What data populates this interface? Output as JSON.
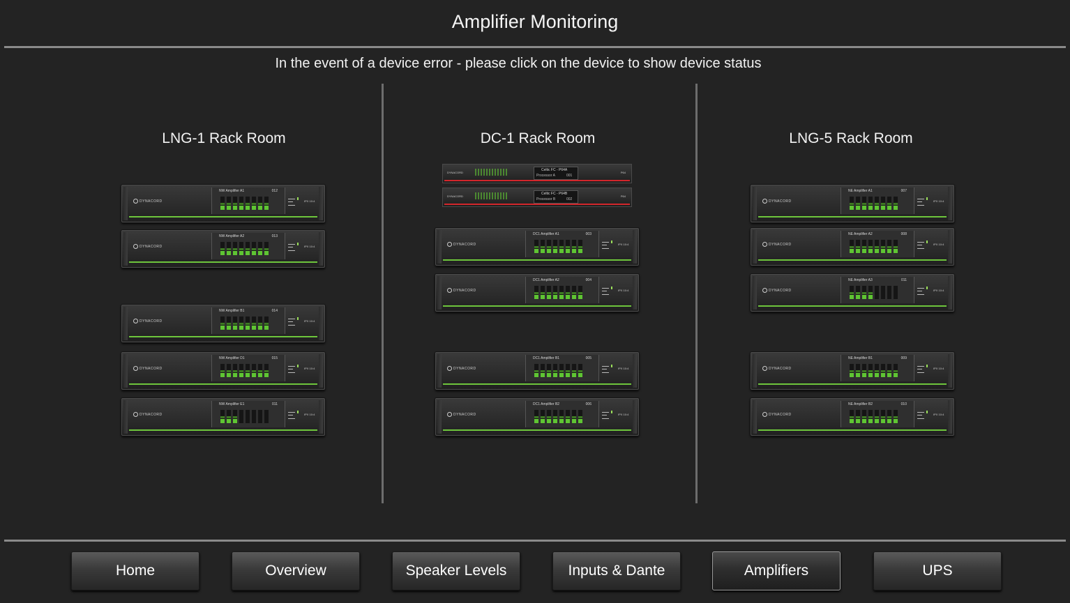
{
  "page": {
    "title": "Amplifier Monitoring",
    "subtitle": "In the event of a device error - please click on the device to show device status"
  },
  "rooms": [
    {
      "title": "LNG-1 Rack Room",
      "devices": [
        {
          "name": "NW Amplifier A1",
          "num": "012",
          "model": "IPX 10:4",
          "levels": [
            1,
            1,
            1,
            1,
            1,
            1,
            1,
            1
          ]
        },
        {
          "name": "NW Amplifier A2",
          "num": "013",
          "model": "IPX 10:4",
          "levels": [
            1,
            1,
            1,
            1,
            1,
            1,
            1,
            1
          ]
        },
        {
          "name": "NW Amplifier B1",
          "num": "014",
          "model": "IPX 10:4",
          "levels": [
            1,
            1,
            1,
            1,
            1,
            1,
            1,
            1
          ]
        },
        {
          "name": "NW Amplifier D1",
          "num": "015",
          "model": "IPX 10:4",
          "levels": [
            1,
            1,
            1,
            1,
            1,
            1,
            1,
            1
          ]
        },
        {
          "name": "NW Amplifier E1",
          "num": "011",
          "model": "IPX 10:4",
          "levels": [
            1,
            1,
            1,
            0,
            0,
            0,
            0,
            0
          ]
        }
      ]
    },
    {
      "title": "DC-1 Rack Room",
      "processors": [
        {
          "name": "Celtic FC - P64A",
          "sub": "Processor A",
          "num": "001",
          "model": "P64"
        },
        {
          "name": "Celtic FC - P64B",
          "sub": "Processor B",
          "num": "002",
          "model": "P64"
        }
      ],
      "devices": [
        {
          "name": "DC1 Amplifier A1",
          "num": "003",
          "model": "IPX 10:4",
          "levels": [
            1,
            1,
            1,
            1,
            1,
            1,
            1,
            1
          ]
        },
        {
          "name": "DC1 Amplifier A2",
          "num": "004",
          "model": "IPX 10:4",
          "levels": [
            1,
            1,
            1,
            1,
            1,
            1,
            1,
            1
          ]
        },
        {
          "name": "DC1 Amplifier B1",
          "num": "005",
          "model": "IPX 10:4",
          "levels": [
            1,
            1,
            1,
            1,
            1,
            1,
            1,
            1
          ]
        },
        {
          "name": "DC1 Amplifier B2",
          "num": "006",
          "model": "IPX 10:4",
          "levels": [
            1,
            1,
            1,
            1,
            1,
            1,
            1,
            1
          ]
        }
      ]
    },
    {
      "title": "LNG-5 Rack Room",
      "devices": [
        {
          "name": "NE Amplifier A1",
          "num": "007",
          "model": "IPX 10:4",
          "levels": [
            1,
            1,
            1,
            1,
            1,
            1,
            1,
            1
          ]
        },
        {
          "name": "NE Amplifier A2",
          "num": "008",
          "model": "IPX 10:4",
          "levels": [
            1,
            1,
            1,
            1,
            1,
            1,
            1,
            1
          ]
        },
        {
          "name": "NE Amplifier A3",
          "num": "011",
          "model": "IPX 10:4",
          "levels": [
            1,
            1,
            1,
            1,
            0,
            0,
            0,
            0
          ]
        },
        {
          "name": "NE Amplifier B1",
          "num": "009",
          "model": "IPX 10:4",
          "levels": [
            1,
            1,
            1,
            1,
            1,
            1,
            1,
            1
          ]
        },
        {
          "name": "NE Amplifier B2",
          "num": "010",
          "model": "IPX 10:4",
          "levels": [
            1,
            1,
            1,
            1,
            1,
            1,
            1,
            1
          ]
        }
      ]
    }
  ],
  "nav": {
    "items": [
      "Home",
      "Overview",
      "Speaker Levels",
      "Inputs & Dante",
      "Amplifiers",
      "UPS"
    ],
    "active": "Amplifiers"
  },
  "colors": {
    "background": "#232323",
    "level_green": "#5fc533",
    "status_bar_green": "#6ec63c",
    "processor_red": "#d3262b"
  },
  "brand": {
    "logo_text": "DYNACORD"
  }
}
